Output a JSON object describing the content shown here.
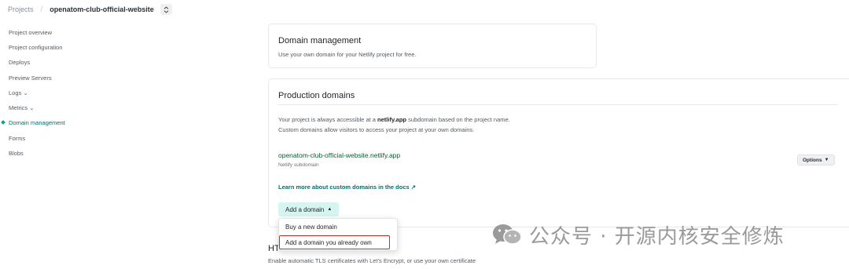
{
  "breadcrumb": {
    "projects": "Projects",
    "separator": "/",
    "current": "openatom-club-official-website",
    "switch_icon": "chevron-up-down-icon"
  },
  "sidebar": {
    "items": [
      {
        "label": "Project overview"
      },
      {
        "label": "Project configuration"
      },
      {
        "label": "Deploys"
      },
      {
        "label": "Preview Servers"
      },
      {
        "label": "Logs ⌄"
      },
      {
        "label": "Metrics ⌄"
      },
      {
        "label": "Domain management",
        "active": true
      },
      {
        "label": "Forms"
      },
      {
        "label": "Blobs"
      }
    ]
  },
  "domain_management": {
    "title": "Domain management",
    "description": "Use your own domain for your Netlify project for free."
  },
  "production_domains": {
    "title": "Production domains",
    "intro_before": "Your project is always accessible at a ",
    "intro_bold": "netlify.app",
    "intro_after": " subdomain based on the project name.",
    "intro_line2": "Custom domains allow visitors to access your project at your own domains.",
    "domain": "openatom-club-official-website.netlify.app",
    "domain_sub": "Netlify subdomain",
    "options_label": "Options",
    "learn_more": "Learn more about custom domains in the docs ↗",
    "add_domain_label": "Add a domain"
  },
  "dropdown": {
    "items": [
      "Buy a new domain",
      "Add a domain you already own"
    ]
  },
  "https": {
    "title": "HTTPS",
    "description": "Enable automatic TLS certificates with Let’s Encrypt, or use your own certificate"
  },
  "watermark": {
    "text": "公众号 · 开源内核安全修炼",
    "icon": "wechat-icon"
  },
  "colors": {
    "accent": "#00706d",
    "add_button_bg": "#d6f4f1",
    "highlight_box": "#e02424",
    "domain_text": "#0b5c2c"
  }
}
